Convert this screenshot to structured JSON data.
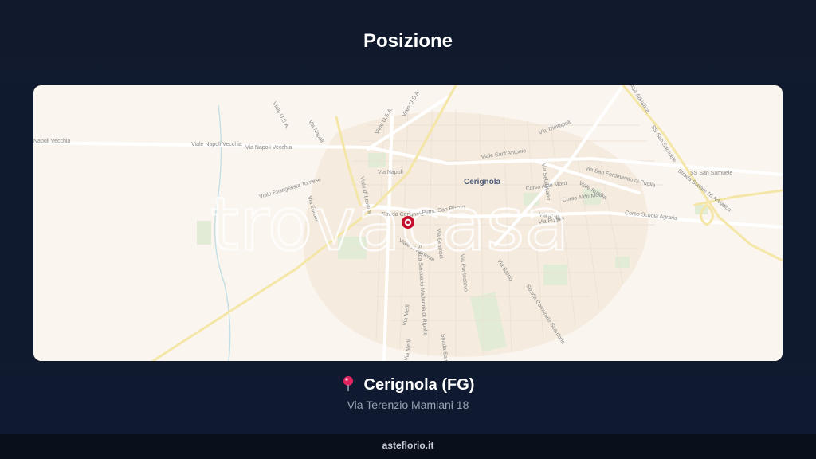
{
  "header": {
    "title": "Posizione"
  },
  "map": {
    "city_label": "Cerignola",
    "watermark": "trovacasa",
    "street_labels": [
      "Viale U.S.A.",
      "Viale U.S.A.",
      "Viale U.S.A.",
      "Via Napoli",
      "Napoli Vecchia",
      "Viale Napoli Vecchia",
      "Via Napoli Vecchia",
      "Via Napoli",
      "Viale di Levante",
      "Viale Evangelista Tornese",
      "Via Europa",
      "Strada Cerignola",
      "Piano San Rocco",
      "Viale di Ponente",
      "Via Gramsci",
      "Strada Santuario Madonna di Ripalta",
      "Via Pontecorvo",
      "Via Melfi",
      "Via Melfi",
      "Viale Sant'Antonio",
      "Via Trinitapoli",
      "Via Sebastiano",
      "Corso Aldo Moro",
      "Corso Aldo Moro",
      "Viale Russia",
      "Via Molise",
      "Via Puglia",
      "Via San Ferdinando di Puglia",
      "Corso Scuola Agraria",
      "Via Sarno",
      "Strada Comunale Scardone",
      "SS San Samuele",
      "Strada Statale 16 Adriatica",
      "A14 Adriatica",
      "SS San Samuele",
      "Strada San"
    ]
  },
  "location": {
    "city": "Cerignola (FG)",
    "address": "Via Terenzio Mamiani 18",
    "icon": "pin-icon"
  },
  "footer": {
    "site": "asteflorio.it"
  },
  "colors": {
    "background": "#111a2d",
    "map_base": "#fbf5ef",
    "marker": "#c8102e",
    "accent_pin": "#e0245e"
  }
}
